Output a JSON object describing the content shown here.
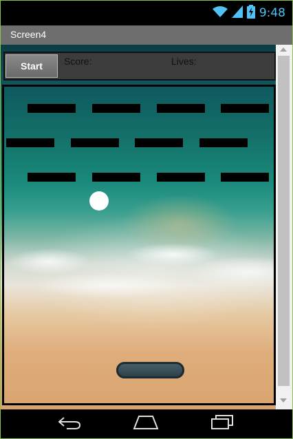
{
  "status_bar": {
    "time": "9:48",
    "icons": [
      "wifi-icon",
      "signal-icon",
      "battery-charging-icon"
    ],
    "accent_color": "#4fc3f7"
  },
  "title_bar": {
    "title": "Screen4"
  },
  "toolbar": {
    "start_label": "Start",
    "score_label": "Score:",
    "lives_label": "Lives:"
  },
  "game": {
    "brick_rows": 3,
    "brick_cols": 4,
    "brick_color": "#000000",
    "ball_color": "#ffffff",
    "paddle_color": "#3a5560"
  },
  "nav_bar": {
    "icons": [
      "back-icon",
      "home-icon",
      "recents-icon"
    ]
  }
}
